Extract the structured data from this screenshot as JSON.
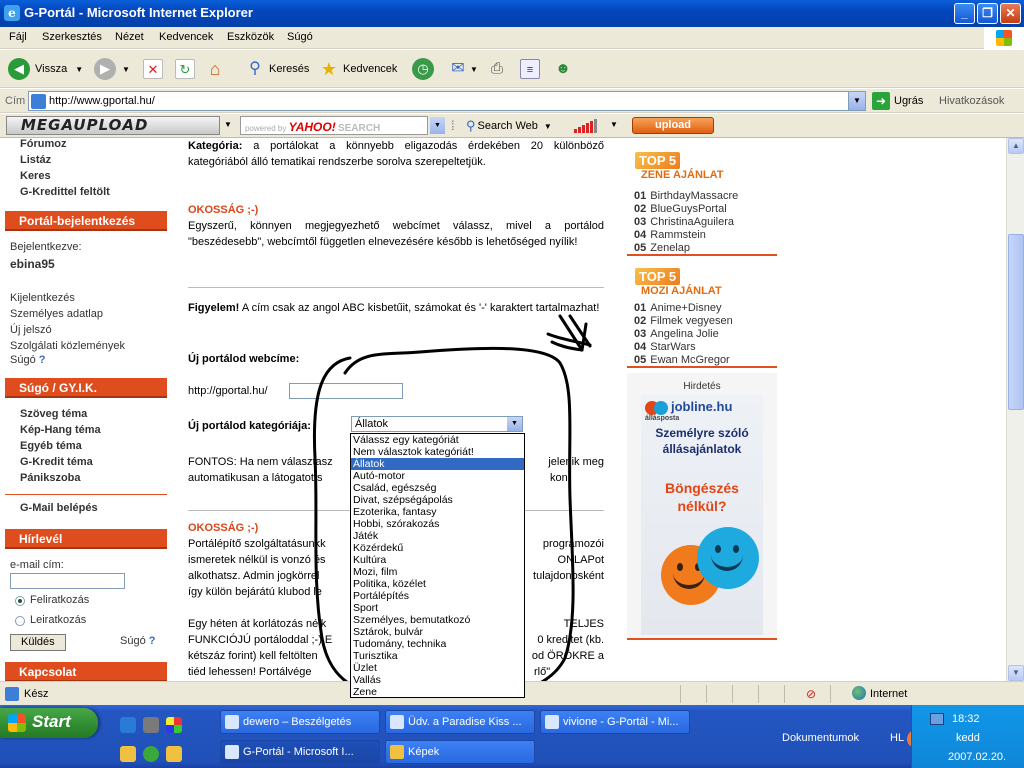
{
  "window": {
    "title": "G-Portál - Microsoft Internet Explorer",
    "minimize": "_",
    "maximize": "❐",
    "close": "✕"
  },
  "menu": [
    "Fájl",
    "Szerkesztés",
    "Nézet",
    "Kedvencek",
    "Eszközök",
    "Súgó"
  ],
  "toolbar": {
    "back_label": "Vissza",
    "search_label": "Keresés",
    "favorites_label": "Kedvencek"
  },
  "address": {
    "label": "Cím",
    "url": "http://www.gportal.hu/",
    "go_label": "Ugrás",
    "links_label": "Hivatkozások"
  },
  "megabar": {
    "logo": "MEGAUPLOAD",
    "powered_by": "powered by",
    "yahoo": "YAHOO!",
    "yahoo_search": "SEARCH",
    "search_web": "Search Web",
    "upload": "upload"
  },
  "left": {
    "top_links": [
      "Fórumoz",
      "Listáz",
      "Keres",
      "G-Kredittel feltölt"
    ],
    "login_header": "Portál-bejelentkezés",
    "logged_in_label": "Bejelentkezve:",
    "username": "ebina95",
    "account_links": [
      "Kijelentkezés",
      "Személyes adatlap",
      "Új jelszó",
      "Szolgálati közlemények"
    ],
    "help_link": "Súgó",
    "help_q": "?",
    "faq_header": "Súgó / GY.I.K.",
    "faq_links": [
      "Szöveg téma",
      "Kép-Hang téma",
      "Egyéb téma",
      "G-Kredit téma",
      "Pánikszoba"
    ],
    "gmail": "G-Mail belépés",
    "newsletter_header": "Hírlevél",
    "email_label": "e-mail cím:",
    "subscribe": "Feliratkozás",
    "unsubscribe": "Leiratkozás",
    "send_button": "Küldés",
    "send_help": "Súgó",
    "contact_header": "Kapcsolat"
  },
  "center": {
    "cat_bold": "Kategória:",
    "cat_text": "a portálokat a könnyebb eligazodás érdekében 20 különböző kategóriából álló tematikai rendszerbe sorolva szerepeltetjük.",
    "tip1_head": "OKOSSÁG ;-)",
    "tip1_text": "Egyszerű, könnyen megjegyezhető webcímet válassz, mivel a portálod \"beszédesebb\", webcímtől független elnevezésére később is lehetőséged nyílik!",
    "warn_bold": "Figyelem!",
    "warn_text": "A cím csak az angol ABC kisbetűit, számokat és '-' karaktert tartalmazhat!",
    "address_label": "Új portálod webcíme:",
    "address_prefix": "http://gportal.hu/",
    "category_label": "Új portálod kategóriája:",
    "category_selected": "Állatok",
    "fontos_a": "FONTOS: Ha nem választasz",
    "fontos_b": "jelenik meg",
    "fontos_c": "automatikusan a látogatotts",
    "fontos_d": "kon!",
    "tip2_head": "OKOSSÁG ;-)",
    "tip2_lines": [
      [
        "Portálépítő szolgáltatásunkk",
        "programozói"
      ],
      [
        "ismeretek nélkül is vonzó és",
        "ONLAPot"
      ],
      [
        "alkothatsz. Admin jogkörrel",
        "tulajdonosként"
      ],
      [
        "így külön bejárátú klubod le",
        ""
      ]
    ],
    "tip3_lines": [
      [
        "Egy héten át korlátozás nélk",
        "TELJES"
      ],
      [
        "FUNKCIÓJÚ portáloddal ;-) E",
        "0 kreditet (kb."
      ],
      [
        "kétszáz forint) kell feltölten",
        "od ÖRÖKRE a"
      ],
      [
        "tiéd lehessen! Portálvége",
        "rlő\""
      ]
    ]
  },
  "dropdown_options": [
    "Válassz egy kategóriát",
    "Nem választok kategóriát!",
    "Állatok",
    "Autó-motor",
    "Család, egészség",
    "Divat, szépségápolás",
    "Ezoterika, fantasy",
    "Hobbi, szórakozás",
    "Játék",
    "Közérdekű",
    "Kultúra",
    "Mozi, film",
    "Politika, közélet",
    "Portálépítés",
    "Sport",
    "Személyes, bemutatkozó",
    "Sztárok, bulvár",
    "Tudomány, technika",
    "Turisztika",
    "Üzlet",
    "Vallás",
    "Zene"
  ],
  "right": {
    "music": {
      "badge": "TOP 5",
      "title": "ZENE AJÁNLAT",
      "items": [
        {
          "num": "01",
          "name": "BirthdayMassacre"
        },
        {
          "num": "02",
          "name": "BlueGuysPortal"
        },
        {
          "num": "03",
          "name": "ChristinaAguilera"
        },
        {
          "num": "04",
          "name": "Rammstein"
        },
        {
          "num": "05",
          "name": "Zenelap"
        }
      ]
    },
    "movie": {
      "badge": "TOP 5",
      "title": "MOZI AJÁNLAT",
      "items": [
        {
          "num": "01",
          "name": "Anime+Disney"
        },
        {
          "num": "02",
          "name": "Filmek vegyesen"
        },
        {
          "num": "03",
          "name": "Angelina Jolie"
        },
        {
          "num": "04",
          "name": "StarWars"
        },
        {
          "num": "05",
          "name": "Ewan McGregor"
        }
      ]
    },
    "ad": {
      "title": "Hirdetés",
      "brand": "jobline.hu",
      "brand_small": "állásposta",
      "line1": "Személyre szóló",
      "line2": "állásajánlatok",
      "cta1": "Böngészés",
      "cta2": "nélkül?"
    }
  },
  "status": {
    "text": "Kész",
    "zone": "Internet"
  },
  "taskbar": {
    "start": "Start",
    "tasks": [
      "dewero – Beszélgetés",
      "Üdv. a Paradise Kiss ...",
      "vivione - G-Portál - Mi...",
      "G-Portál - Microsoft I...",
      "Képek"
    ],
    "documents": "Dokumentumok",
    "lang": "HL",
    "time": "18:32",
    "day": "kedd",
    "date": "2007.02.20."
  },
  "colors": {
    "accent_red": "#df4c1e",
    "link_blue": "#3a68c8",
    "xp_blue": "#2456c2",
    "start_green": "#2f8b2f"
  }
}
